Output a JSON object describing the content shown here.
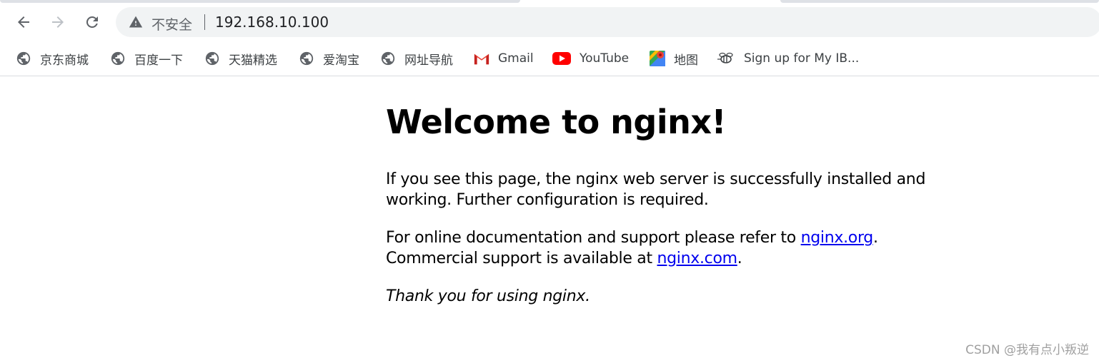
{
  "browser": {
    "security_label": "不安全",
    "url": "192.168.10.100"
  },
  "bookmarks": [
    {
      "label": "京东商城",
      "icon": "globe-icon"
    },
    {
      "label": "百度一下",
      "icon": "globe-icon"
    },
    {
      "label": "天猫精选",
      "icon": "globe-icon"
    },
    {
      "label": "爱淘宝",
      "icon": "globe-icon"
    },
    {
      "label": "网址导航",
      "icon": "globe-icon"
    },
    {
      "label": "Gmail",
      "icon": "gmail-icon"
    },
    {
      "label": "YouTube",
      "icon": "youtube-icon"
    },
    {
      "label": "地图",
      "icon": "maps-icon"
    },
    {
      "label": "Sign up for My IB...",
      "icon": "bee-icon"
    }
  ],
  "page": {
    "title": "Welcome to nginx!",
    "para1": "If you see this page, the nginx web server is successfully installed and working. Further configuration is required.",
    "para2_prefix": "For online documentation and support please refer to ",
    "link_org": "nginx.org",
    "para2_mid": ".",
    "para2_line2": "Commercial support is available at ",
    "link_com": "nginx.com",
    "para2_end": ".",
    "thanks": "Thank you for using nginx."
  },
  "watermark": "CSDN @我有点小叛逆",
  "colors": {
    "link": "#0000ee",
    "youtube_red": "#ff0000",
    "omnibox_bg": "#f1f3f4"
  }
}
